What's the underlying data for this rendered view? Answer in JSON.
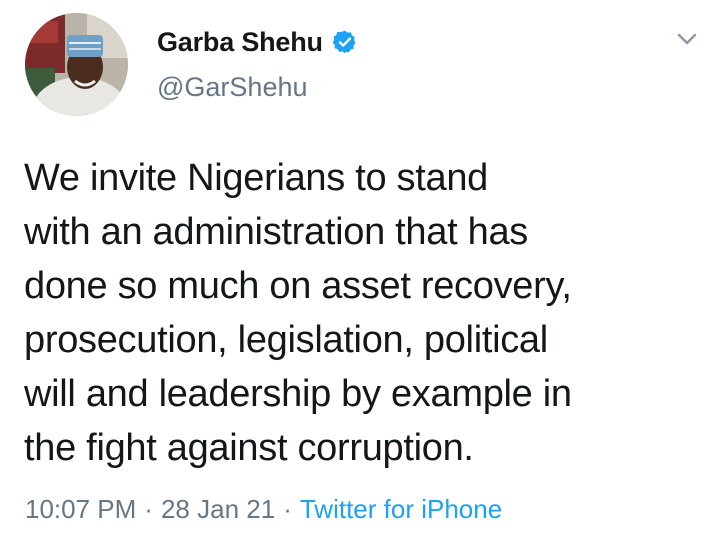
{
  "tweet": {
    "author": {
      "display_name": "Garba Shehu",
      "handle": "@GarShehu",
      "verified": true,
      "avatar_icon": "profile-photo"
    },
    "text": "We invite Nigerians to stand\nwith an administration that has\ndone so much on asset recovery,\nprosecution, legislation, political\nwill and leadership by example in\nthe fight against corruption.",
    "time": "10:07 PM",
    "date": "28 Jan 21",
    "source": "Twitter for iPhone",
    "separator": "·",
    "menu_icon": "chevron-down-icon"
  },
  "colors": {
    "text": "#14171a",
    "secondary": "#657786",
    "link": "#1da1f2",
    "verified": "#1da1f2"
  }
}
